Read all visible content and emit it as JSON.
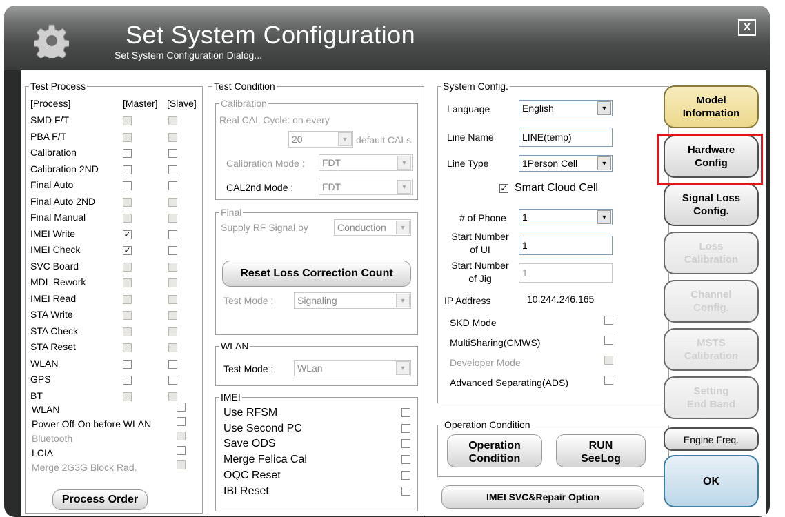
{
  "window": {
    "title": "Set System Configuration",
    "subtitle": "Set System Configuration Dialog...",
    "close_label": "X"
  },
  "test_process": {
    "legend": "Test Process",
    "col_process": "[Process]",
    "col_master": "[Master]",
    "col_slave": "[Slave]",
    "rows": [
      {
        "label": "SMD F/T",
        "master": "disabled",
        "slave": "disabled"
      },
      {
        "label": "PBA F/T",
        "master": "disabled",
        "slave": "disabled"
      },
      {
        "label": "Calibration",
        "master": "unchecked",
        "slave": "unchecked"
      },
      {
        "label": "Calibration 2ND",
        "master": "unchecked",
        "slave": "unchecked"
      },
      {
        "label": "Final Auto",
        "master": "unchecked",
        "slave": "unchecked"
      },
      {
        "label": "Final Auto 2ND",
        "master": "disabled",
        "slave": "disabled"
      },
      {
        "label": "Final Manual",
        "master": "disabled",
        "slave": "disabled"
      },
      {
        "label": "IMEI Write",
        "master": "checked",
        "slave": "unchecked"
      },
      {
        "label": "IMEI Check",
        "master": "checked",
        "slave": "unchecked"
      },
      {
        "label": "SVC Board",
        "master": "disabled",
        "slave": "disabled"
      },
      {
        "label": "MDL Rework",
        "master": "disabled",
        "slave": "disabled"
      },
      {
        "label": "IMEI Read",
        "master": "disabled",
        "slave": "disabled"
      },
      {
        "label": "STA Write",
        "master": "disabled",
        "slave": "disabled"
      },
      {
        "label": "STA Check",
        "master": "disabled",
        "slave": "disabled"
      },
      {
        "label": "STA Reset",
        "master": "disabled",
        "slave": "disabled"
      },
      {
        "label": "WLAN",
        "master": "unchecked",
        "slave": "unchecked"
      },
      {
        "label": "GPS",
        "master": "unchecked",
        "slave": "unchecked"
      },
      {
        "label": "BT",
        "master": "disabled",
        "slave": "disabled"
      }
    ],
    "extras": [
      {
        "label": "WLAN",
        "state": "unchecked",
        "enabled": true
      },
      {
        "label": "Power Off-On before WLAN",
        "state": "unchecked",
        "enabled": true
      },
      {
        "label": "Bluetooth",
        "state": "disabled",
        "enabled": false
      },
      {
        "label": "LCIA",
        "state": "unchecked",
        "enabled": true
      },
      {
        "label": "Merge 2G3G Block Rad.",
        "state": "disabled",
        "enabled": false
      }
    ],
    "process_order_label": "Process Order"
  },
  "test_condition": {
    "legend": "Test Condition",
    "calibration": {
      "legend": "Calibration",
      "cycle_label": "Real CAL Cycle: on every",
      "cycle_value": "20",
      "default_cals": "default CALs",
      "mode_label": "Calibration Mode :",
      "mode_value": "FDT",
      "cal2nd_label": "CAL2nd Mode :",
      "cal2nd_value": "FDT"
    },
    "final": {
      "legend": "Final",
      "supply_label": "Supply RF Signal by",
      "supply_value": "Conduction",
      "reset_label": "Reset Loss Correction Count",
      "test_mode_label": "Test Mode :",
      "test_mode_value": "Signaling"
    },
    "wlan": {
      "legend": "WLAN",
      "test_mode_label": "Test Mode :",
      "test_mode_value": "WLan"
    },
    "imei": {
      "legend": "IMEI",
      "options": [
        "Use RFSM",
        "Use Second PC",
        "Save ODS",
        "Merge Felica Cal",
        "OQC Reset",
        "IBI Reset"
      ]
    }
  },
  "system_config": {
    "legend": "System Config.",
    "language_label": "Language",
    "language_value": "English",
    "line_name_label": "Line Name",
    "line_name_value": "LINE(temp)",
    "line_type_label": "Line Type",
    "line_type_value": "1Person Cell",
    "smart_cloud_label": "Smart Cloud Cell",
    "phone_label": "# of Phone",
    "phone_value": "1",
    "start_ui_label_1": "Start Number",
    "start_ui_label_2": "of UI",
    "start_ui_value": "1",
    "start_jig_label_1": "Start Number",
    "start_jig_label_2": "of Jig",
    "start_jig_value": "1",
    "ip_label": "IP Address",
    "ip_value": "10.244.246.165",
    "options": [
      {
        "label": "SKD Mode",
        "enabled": true
      },
      {
        "label": "MultiSharing(CMWS)",
        "enabled": true
      },
      {
        "label": "Developer Mode",
        "enabled": false
      },
      {
        "label": "Advanced Separating(ADS)",
        "enabled": true
      }
    ]
  },
  "operation_condition": {
    "legend": "Operation Condition",
    "op_btn_1": "Operation",
    "op_btn_2": "Condition",
    "run_btn_1": "RUN",
    "run_btn_2": "SeeLog"
  },
  "imei_svc_label": "IMEI SVC&Repair Option",
  "right_buttons": [
    {
      "l1": "Model",
      "l2": "Information",
      "enabled": true
    },
    {
      "l1": "Hardware",
      "l2": "Config",
      "enabled": true
    },
    {
      "l1": "Signal Loss",
      "l2": "Config.",
      "enabled": true
    },
    {
      "l1": "Loss",
      "l2": "Calibration",
      "enabled": false
    },
    {
      "l1": "Channel",
      "l2": "Config.",
      "enabled": false
    },
    {
      "l1": "MSTS",
      "l2": "Calibration",
      "enabled": false
    },
    {
      "l1": "Setting",
      "l2": "End Band",
      "enabled": false
    }
  ],
  "engine_freq_label": "Engine Freq.",
  "ok_label": "OK",
  "colors": {
    "highlight": "#e0161b",
    "model_btn": "#ecd98c",
    "ok_btn": "#cfe3ef"
  }
}
